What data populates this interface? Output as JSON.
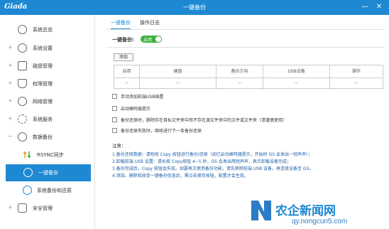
{
  "app": {
    "logo": "Giada",
    "title": "一键备份",
    "min_glyph": "—",
    "close_glyph": "✕",
    "accent": "#1e89d2"
  },
  "sidebar": {
    "items": [
      {
        "label": "系统总览",
        "expand": "",
        "icon": "monitor-icon"
      },
      {
        "label": "系统设置",
        "expand": "+",
        "icon": "gear-icon"
      },
      {
        "label": "磁盘管理",
        "expand": "+",
        "icon": "disk-icon"
      },
      {
        "label": "权限管理",
        "expand": "+",
        "icon": "shield-icon"
      },
      {
        "label": "网络管理",
        "expand": "+",
        "icon": "globe-icon"
      },
      {
        "label": "系统服务",
        "expand": "+",
        "icon": "service-icon"
      },
      {
        "label": "数据备份",
        "expand": "−",
        "icon": "clock-icon"
      },
      {
        "label": "RSYNC同步",
        "expand": "",
        "icon": "sync-arrows-icon"
      },
      {
        "label": "一键备份",
        "expand": "",
        "icon": "backup-icon",
        "active": true
      },
      {
        "label": "系统备份和还原",
        "expand": "",
        "icon": "restore-icon"
      },
      {
        "label": "安全管理",
        "expand": "+",
        "icon": "lock-icon"
      }
    ]
  },
  "tabs": [
    {
      "label": "一键备份",
      "active": true
    },
    {
      "label": "操作日志",
      "active": false
    }
  ],
  "backup": {
    "label": "一键备份:",
    "toggle_label": "启用",
    "enabled": true,
    "toggle_color": "#3bb03b"
  },
  "add_button": "添加",
  "table": {
    "headers": [
      "启用",
      "硬盘",
      "备份方向",
      "USB设备",
      "操作"
    ],
    "rows": [
      [
        "--",
        "--",
        "--",
        "--",
        "--"
      ]
    ]
  },
  "options": [
    {
      "label": "手动添加前端USB插置"
    },
    {
      "label": "启动蜂鸣器提示"
    },
    {
      "label": "备份还原时，删除存在目标文件夹中而不存在源文件夹中的文件或文件夹（请谨慎使用）"
    },
    {
      "label": "备份还原失败时，继续进行下一条备份还原"
    }
  ],
  "notes": {
    "title": "注意：",
    "items": [
      "1.备份还原数据：请短按 Copy 按钮进行备份/还原（如已启动蜂鸣器提示，开始时 GS 会发出一短声声）；",
      "2.卸载前端 USB 设置：请长按 Copy按钮 4~5 秒，GS 会发出两短声声，表示卸载设备完成；",
      "3.备份完成后，Copy 按钮会失效。如要再次使用备份功能，请先移除前端 USB 设备，再连接设备至 GS。",
      "4.添加、删除和改变一键备份信息后，需点击保存按钮，配置才会生效。"
    ]
  },
  "watermark": {
    "logo_color": "#2a7cc7",
    "text": "农企新闻网",
    "url": "qy.nongcun5.com"
  }
}
